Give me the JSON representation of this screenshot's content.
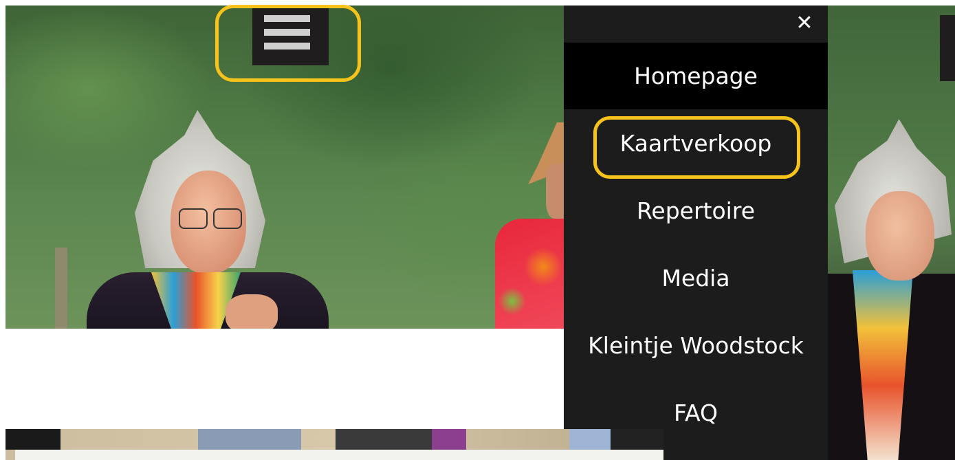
{
  "header": {
    "menu_toggle_icon": "hamburger-icon",
    "close_icon_glyph": "✕"
  },
  "menu": {
    "items": [
      {
        "label": "Homepage",
        "active": true
      },
      {
        "label": "Kaartverkoop",
        "active": false
      },
      {
        "label": "Repertoire",
        "active": false
      },
      {
        "label": "Media",
        "active": false
      },
      {
        "label": "Kleintje Woodstock",
        "active": false
      },
      {
        "label": "FAQ",
        "active": false
      }
    ]
  },
  "colors": {
    "menu_background": "#1c1c1c",
    "active_item_background": "#000000",
    "highlight_annotation": "#f6c21c",
    "menu_text": "#ffffff"
  }
}
